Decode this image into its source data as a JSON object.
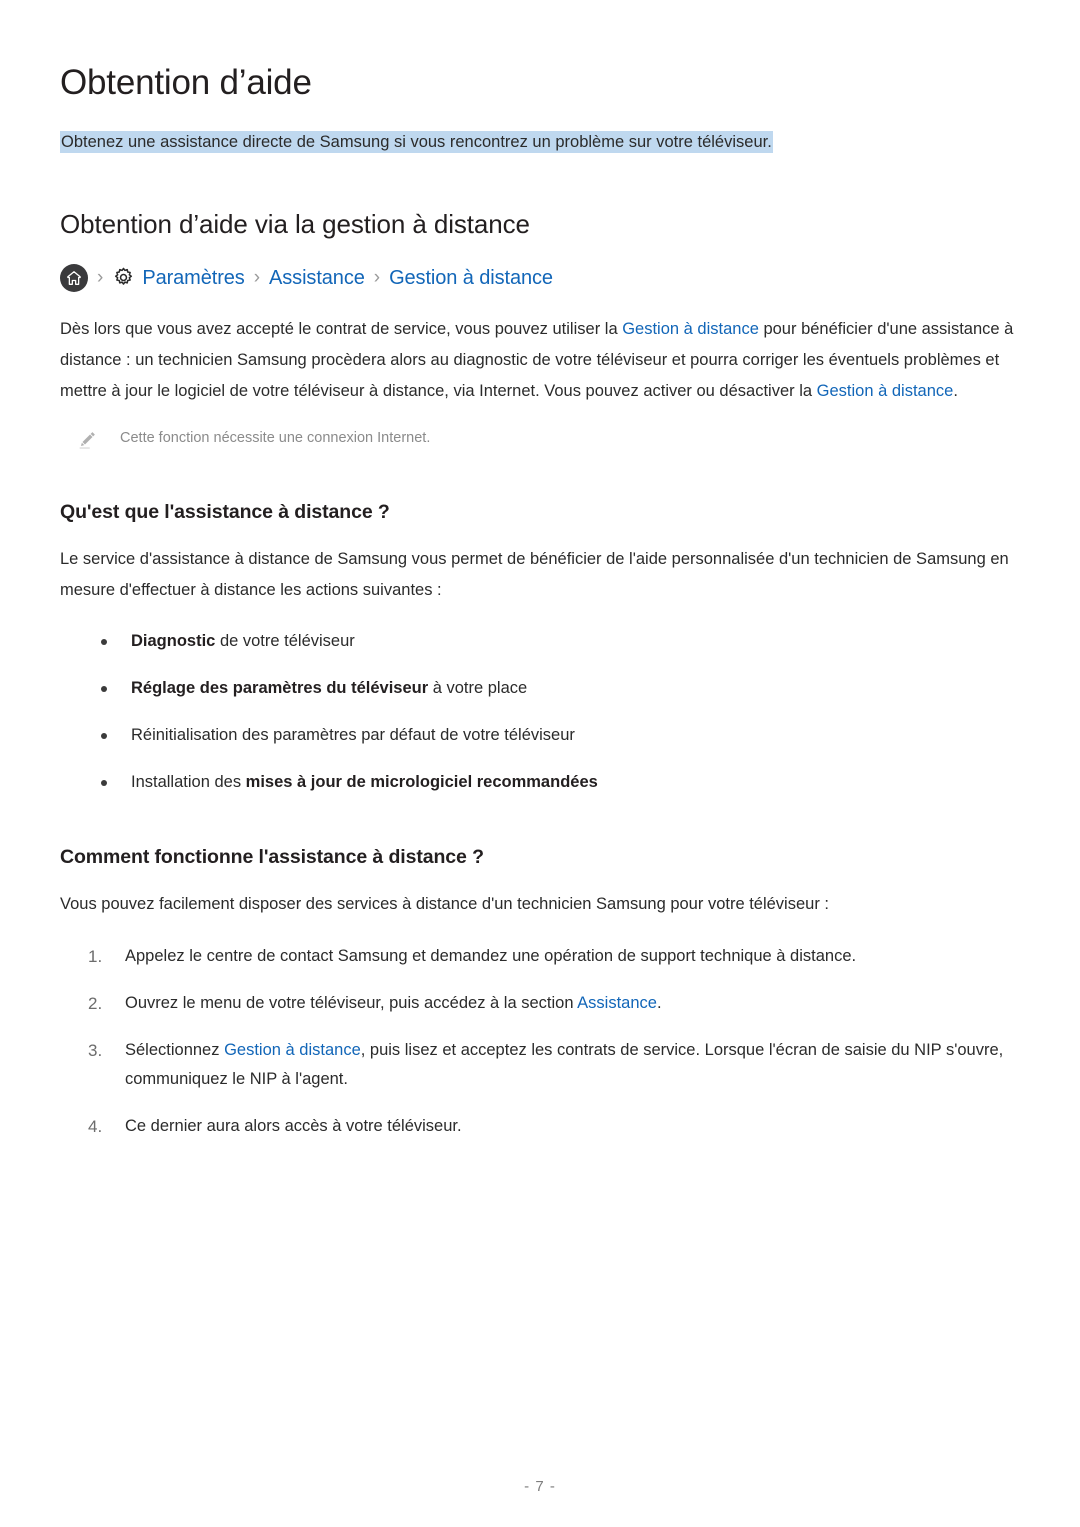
{
  "document": {
    "title": "Obtention d’aide",
    "intro_highlighted": "Obtenez une assistance directe de Samsung si vous rencontrez un problème sur votre téléviseur.",
    "highlight_color": "#bfd8ef",
    "link_color": "#1266b8",
    "text_color": "#2b2b2b"
  },
  "section": {
    "heading": "Obtention d’aide via la gestion à distance",
    "breadcrumb": {
      "home_icon": "home-icon",
      "gear_icon": "gear-icon",
      "separator": "›",
      "items": [
        {
          "label": "Paramètres"
        },
        {
          "label": "Assistance"
        },
        {
          "label": "Gestion à distance"
        }
      ]
    },
    "paragraph": {
      "part1": "Dès lors que vous avez accepté le contrat de service, vous pouvez utiliser la ",
      "link1": "Gestion à distance",
      "part2": " pour bénéficier d'une assistance à distance : un technicien Samsung procèdera alors au diagnostic de votre téléviseur et pourra corriger les éventuels problèmes et mettre à jour le logiciel de votre téléviseur à distance, via Internet. Vous pouvez activer ou désactiver la ",
      "link2": "Gestion à distance",
      "part3": "."
    },
    "note": {
      "icon": "pencil-icon",
      "text": "Cette fonction nécessite une connexion Internet."
    }
  },
  "subsection_what": {
    "heading": "Qu'est que l'assistance à distance ?",
    "intro": "Le service d'assistance à distance de Samsung vous permet de bénéficier de l'aide personnalisée d'un technicien de Samsung en mesure d'effectuer à distance les actions suivantes :",
    "bullets": [
      {
        "bold": "Diagnostic",
        "rest": " de votre téléviseur",
        "bold_first": true
      },
      {
        "bold": "Réglage des paramètres du téléviseur",
        "rest": " à votre place",
        "bold_first": true
      },
      {
        "bold": "",
        "rest": "Réinitialisation des paramètres par défaut de votre téléviseur",
        "bold_first": false
      },
      {
        "lead": "Installation des ",
        "bold": "mises à jour de micrologiciel recommandées",
        "rest": "",
        "bold_first": false
      }
    ]
  },
  "subsection_how": {
    "heading": "Comment fonctionne l'assistance à distance ?",
    "intro": "Vous pouvez facilement disposer des services à distance d'un technicien Samsung pour votre téléviseur :",
    "steps": [
      {
        "num": "1.",
        "part1": "Appelez le centre de contact Samsung et demandez une opération de support technique à distance.",
        "link": "",
        "part2": ""
      },
      {
        "num": "2.",
        "part1": "Ouvrez le menu de votre téléviseur, puis accédez à la section ",
        "link": "Assistance",
        "part2": "."
      },
      {
        "num": "3.",
        "part1": "Sélectionnez ",
        "link": "Gestion à distance",
        "part2": ", puis lisez et acceptez les contrats de service. Lorsque l'écran de saisie du NIP s'ouvre, communiquez le NIP à l'agent."
      },
      {
        "num": "4.",
        "part1": "Ce dernier aura alors accès à votre téléviseur.",
        "link": "",
        "part2": ""
      }
    ]
  },
  "footer": {
    "page_number": "- 7 -"
  }
}
